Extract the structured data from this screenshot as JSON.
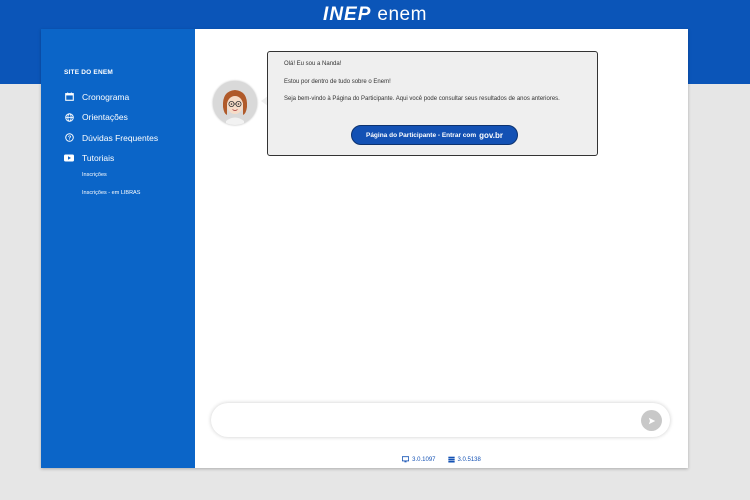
{
  "header": {
    "logo_inep": "INEP",
    "logo_enem": "enem"
  },
  "sidebar": {
    "site_label": "SITE DO ENEM",
    "items": [
      {
        "label": "Cronograma",
        "icon": "calendar-icon"
      },
      {
        "label": "Orientações",
        "icon": "globe-icon"
      },
      {
        "label": "Dúvidas Frequentes",
        "icon": "question-icon"
      },
      {
        "label": "Tutoriais",
        "icon": "video-icon"
      }
    ],
    "sub_items": [
      "Inscrições",
      "Inscrições - em LIBRAS"
    ]
  },
  "chat": {
    "messages": [
      "Olá! Eu sou a Nanda!",
      "Estou por dentro de tudo sobre o Enem!",
      "Seja bem-vindo à Página do Participante. Aqui você pode consultar seus resultados de anos anteriores."
    ],
    "login_button": {
      "label": "Página do Participante - Entrar com",
      "brand": "gov.br"
    },
    "input_placeholder": ""
  },
  "footer": {
    "front_version": "3.0.1097",
    "back_version": "3.0.5138"
  },
  "colors": {
    "primary": "#0b65c8",
    "header": "#0b55b8",
    "button": "#1351b4"
  }
}
